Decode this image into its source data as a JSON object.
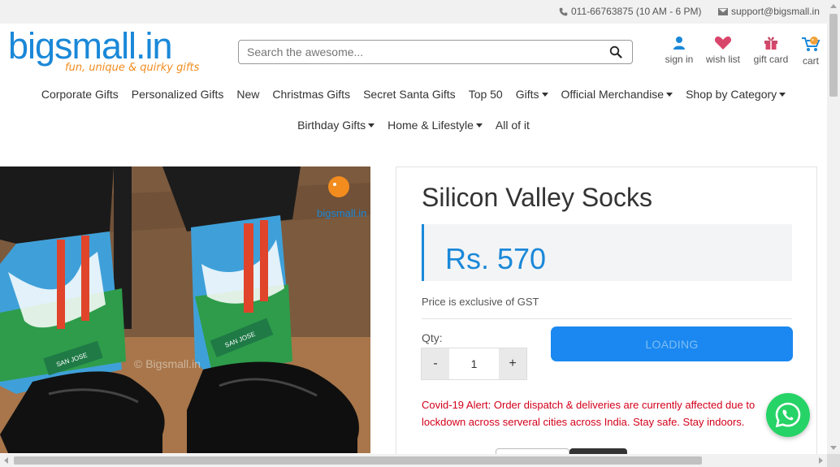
{
  "topbar": {
    "phone": "011-66763875 (10 AM - 6 PM)",
    "email": "support@bigsmall.in"
  },
  "logo": {
    "wordmark": "bigsmall.in",
    "tagline": "fun, unique & quirky gifts"
  },
  "search": {
    "placeholder": "Search the awesome..."
  },
  "header_icons": {
    "signin": "sign in",
    "wishlist": "wish list",
    "giftcard": "gift card",
    "cart": "cart"
  },
  "nav": {
    "row1": [
      {
        "label": "Corporate Gifts",
        "dropdown": false
      },
      {
        "label": "Personalized Gifts",
        "dropdown": false
      },
      {
        "label": "New",
        "dropdown": false
      },
      {
        "label": "Christmas Gifts",
        "dropdown": false
      },
      {
        "label": "Secret Santa Gifts",
        "dropdown": false
      },
      {
        "label": "Top 50",
        "dropdown": false
      },
      {
        "label": "Gifts",
        "dropdown": true
      },
      {
        "label": "Official Merchandise",
        "dropdown": true
      },
      {
        "label": "Shop by Category",
        "dropdown": true
      }
    ],
    "row2": [
      {
        "label": "Birthday Gifts",
        "dropdown": true
      },
      {
        "label": "Home & Lifestyle",
        "dropdown": true
      },
      {
        "label": "All of it",
        "dropdown": false
      }
    ]
  },
  "product": {
    "title": "Silicon Valley Socks",
    "price": "Rs. 570",
    "gst_note": "Price is exclusive of GST",
    "qty_label": "Qty:",
    "qty_minus": "-",
    "qty_value": "1",
    "qty_plus": "+",
    "button_label": "LOADING",
    "alert": "Covid-19 Alert: Order dispatch & deliveries are currently affected due to lockdown across serveral cities across India. Stay safe. Stay indoors.",
    "image_watermark": "© Bigsmall.in",
    "image_logo_text": "bigsmall.in",
    "sign_left": "SAN JOSE",
    "sign_right": "SAN JOSE"
  },
  "colors": {
    "brand_blue": "#1a88d8",
    "brand_orange": "#f28c1e",
    "alert_red": "#d3001b",
    "button_blue": "#1a88f0",
    "whatsapp_green": "#25d366"
  }
}
